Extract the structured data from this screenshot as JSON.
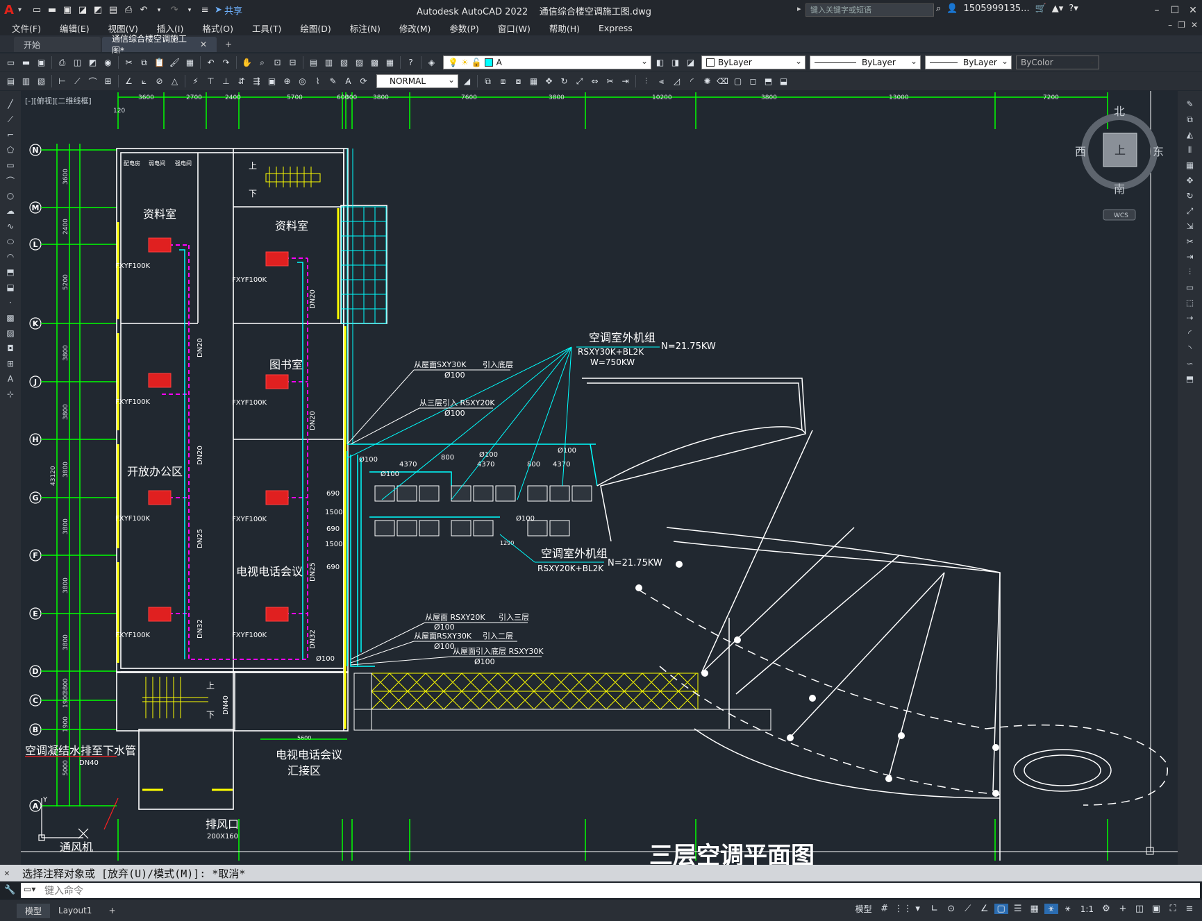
{
  "window": {
    "app_title": "Autodesk AutoCAD 2022",
    "file_title": "通信综合楼空调施工图.dwg",
    "share_label": "共享",
    "search_placeholder": "键入关键字或短语",
    "user_name": "1505999135...",
    "controls": [
      "–",
      "☐",
      "✕"
    ]
  },
  "menu": [
    "文件(F)",
    "编辑(E)",
    "视图(V)",
    "插入(I)",
    "格式(O)",
    "工具(T)",
    "绘图(D)",
    "标注(N)",
    "修改(M)",
    "参数(P)",
    "窗口(W)",
    "帮助(H)",
    "Express"
  ],
  "tabs": [
    {
      "label": "开始",
      "active": false
    },
    {
      "label": "通信综合楼空调施工图*",
      "active": true,
      "closable": true
    }
  ],
  "toolbar": {
    "layer_name": "A",
    "color": "ByLayer",
    "linetype": "ByLayer",
    "lineweight": "ByLayer",
    "plotstyle": "ByColor",
    "dimstyle": "NORMAL",
    "layer_swatch_color": "#00ffff"
  },
  "viewport": {
    "label": "[-][俯视][二维线框]",
    "compass": {
      "north": "北",
      "south": "南",
      "east": "东",
      "west": "西",
      "top": "上",
      "wcs": "WCS"
    }
  },
  "drawing": {
    "title_partial": "三层空调平面图",
    "top_dims": [
      "3600",
      "2700",
      "2400",
      "5700",
      "600",
      "300",
      "3800",
      "7600",
      "3800",
      "10200",
      "3800",
      "13000",
      "7200"
    ],
    "first_dim": "120",
    "left_dims": [
      "3600",
      "2400",
      "5200",
      "3800",
      "3800",
      "3800",
      "3800",
      "3800",
      "3800",
      "3800",
      "1900",
      "1900",
      "5000"
    ],
    "total_dim": "43120",
    "grid_labels": [
      "N",
      "M",
      "L",
      "K",
      "J",
      "H",
      "G",
      "F",
      "E",
      "D",
      "C",
      "B",
      "A"
    ],
    "rooms": {
      "r1": "资料室",
      "r2": "资料室",
      "r3": "图书室",
      "r4": "开放办公区",
      "r5": "电视电话会议",
      "r6": "电视电话会议",
      "r6b": "汇接区",
      "exhaust": "排风口",
      "exhaust_size": "200X160",
      "vent_fan": "通风机",
      "drain_note": "空调凝结水排至下水管",
      "drain_size": "DN40",
      "small1": "配电房",
      "small2": "弱电间",
      "small3": "强电间"
    },
    "units": "FXYF100K",
    "pipes": [
      "DN20",
      "DN20",
      "DN20",
      "DN20",
      "DN25",
      "DN25",
      "DN32",
      "DN32",
      "DN40"
    ],
    "outdoor1": {
      "title": "空调室外机组",
      "model": "RSXY30K+BL2K",
      "power": "N=21.75KW",
      "w": "W=750KW"
    },
    "outdoor2": {
      "title": "空调室外机组",
      "model": "RSXY20K+BL2K",
      "power": "N=21.75KW"
    },
    "notes": {
      "n1": "从屋面SXY30K",
      "n1b": "引入底层",
      "n1c": "Ø100",
      "n2": "从三层引入 RSXY20K",
      "n2c": "Ø100",
      "n3": "从屋面 RSXY20K",
      "n3b": "引入三层",
      "n3c": "Ø100",
      "n4": "从屋面RSXY30K",
      "n4b": "引入二层",
      "n4c": "Ø100",
      "n5": "从屋面引入底层 RSXY30K",
      "n5c": "Ø100"
    },
    "outdoor_dims": [
      "Ø100",
      "4370",
      "800",
      "4370",
      "800",
      "4370",
      "Ø100",
      "Ø100",
      "Ø100",
      "690",
      "1500",
      "690",
      "1500",
      "690",
      "Ø100",
      "Ø100",
      "1290",
      "5600"
    ],
    "stair_up": "上",
    "stair_down": "下"
  },
  "command": {
    "history": "选择注释对象或 [放弃(U)/模式(M)]: *取消*",
    "placeholder": "键入命令"
  },
  "status": {
    "tabs": [
      "模型",
      "Layout1"
    ],
    "model_label": "模型",
    "scale": "1:1"
  }
}
